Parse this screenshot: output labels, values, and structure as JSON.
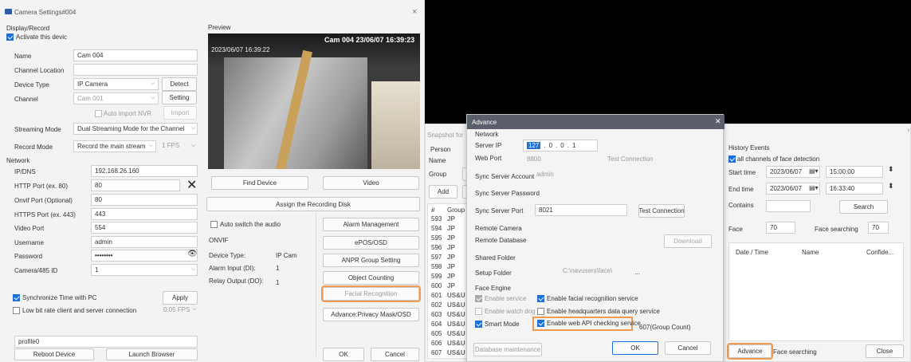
{
  "cam": {
    "title": "Camera Settings#004",
    "close": "×",
    "display_section": "Display/Record",
    "activate": "Activate this devic",
    "labels": {
      "name": "Name",
      "chloc": "Channel Location",
      "devtype": "Device Type",
      "channel": "Channel",
      "stream": "Streaming Mode",
      "record": "Record Mode",
      "network": "Network",
      "ipdns": "IP/DNS",
      "http": "HTTP Port (ex. 80)",
      "onvif": "Onvif Port (Optional)",
      "https": "HTTPS Port (ex. 443)",
      "video": "Video Port",
      "username": "Username",
      "password": "Password",
      "cam485": "Camera/485 ID"
    },
    "values": {
      "name": "Cam 004",
      "devtype": "IP Camera",
      "channel": "Cam 001",
      "stream": "Dual Streaming Mode for the Channel",
      "record": "Record the main stream",
      "fps": "1 FPS",
      "ip": "192.168.26.160",
      "http": "80",
      "onvif": "80",
      "https": "443",
      "video": "554",
      "username": "admin",
      "password": "••••••••",
      "cam485": "1",
      "lowfps": "0.05 FPS",
      "profile": "profile0"
    },
    "buttons": {
      "detect": "Detect",
      "setting": "Setting",
      "import": "Import",
      "apply": "Apply",
      "reboot": "Reboot Device",
      "browser": "Launch Browser",
      "find": "Find Device",
      "video": "Video",
      "assign": "Assign the Recording Disk",
      "alarm": "Alarm Management",
      "epos": "ePOS/OSD",
      "anpr": "ANPR Group Setting",
      "object": "Object Counting",
      "facial": "Facial Recognition",
      "privacy": "Advance:Privacy Mask/OSD",
      "ok": "OK",
      "cancel": "Cancel"
    },
    "auto_import": "Auto import NVR",
    "sync_time": "Synchronize Time with PC",
    "low_bitrate": "Low bit rate client and server connection",
    "preview_label": "Preview",
    "overlay": "Cam 004 23/06/07 16:39:23",
    "overlay_ts": "2023/06/07 16:39:22",
    "auto_audio": "Auto switch the audio",
    "onvif_section": "ONVIF",
    "onvif_rows": [
      {
        "k": "Device Type:",
        "v": "IP Cam"
      },
      {
        "k": "Alarm Input (DI):",
        "v": "1"
      },
      {
        "k": "Relay Output (DO):",
        "v": "1"
      }
    ]
  },
  "snap": {
    "title": "Snapshot for",
    "person": "Person",
    "name": "Name",
    "group": "Group",
    "add": "Add",
    "col_num": "#",
    "col_group": "Group",
    "rows": [
      {
        "n": "593",
        "g": "JP"
      },
      {
        "n": "594",
        "g": "JP"
      },
      {
        "n": "595",
        "g": "JP"
      },
      {
        "n": "596",
        "g": "JP"
      },
      {
        "n": "597",
        "g": "JP"
      },
      {
        "n": "598",
        "g": "JP"
      },
      {
        "n": "599",
        "g": "JP"
      },
      {
        "n": "600",
        "g": "JP"
      },
      {
        "n": "601",
        "g": "US&U"
      },
      {
        "n": "602",
        "g": "US&U"
      },
      {
        "n": "603",
        "g": "US&U"
      },
      {
        "n": "604",
        "g": "US&U"
      },
      {
        "n": "605",
        "g": "US&U"
      },
      {
        "n": "606",
        "g": "US&U"
      },
      {
        "n": "607",
        "g": "US&U"
      }
    ]
  },
  "adv": {
    "title": "Advance",
    "close": "✕",
    "network": "Network",
    "server_ip_l": "Server IP",
    "ip": [
      "127",
      "0",
      "0",
      "1"
    ],
    "web_port_l": "Web Port",
    "web_port": "8800",
    "test_conn": "Test Connection",
    "sync_acc_l": "Sync Server Account",
    "sync_acc": "admin",
    "sync_pwd_l": "Sync Server Password",
    "sync_port_l": "Sync Server Port",
    "sync_port": "8021",
    "remote_cam": "Remote Camera",
    "remote_db": "Remote Database",
    "download": "Download",
    "shared": "Shared Folder",
    "setup_folder": "Setup Folder",
    "folder": "C:\\navusers\\face\\",
    "dots": "...",
    "face_engine": "Face Engine",
    "enable_service": "Enable service",
    "enable_facial": "Enable facial recognition service",
    "enable_watch": "Enable watch dog s",
    "enable_hq": "Enable headquarters data query service",
    "smart": "Smart Mode",
    "enable_web": "Enable web API checking service",
    "group_count": "607(Group Count)",
    "db_maint": "Database maintenance",
    "ok": "OK",
    "cancel": "Cancel"
  },
  "hist": {
    "title": "History Events",
    "all_channels": "all channels of face detection",
    "start": "Start time",
    "start_date": "2023/06/07",
    "start_time": "15:00:00",
    "end": "End time",
    "end_date": "2023/06/07",
    "end_time": "16:33:40",
    "contains": "Contains",
    "search": "Search",
    "face": "Face",
    "face_val": "70",
    "face_search_l": "Face searching",
    "face_search_val": "70",
    "cols": [
      "Date / Time",
      "Name",
      "Confide..."
    ],
    "advance": "Advance",
    "face_searching": "Face searching",
    "close": "Close",
    "edge": "›"
  },
  "colors": {
    "accent": "#1e6fd8",
    "highlight": "#f09a52"
  }
}
